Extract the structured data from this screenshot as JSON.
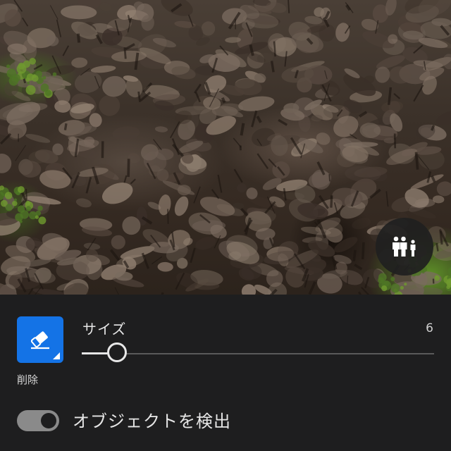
{
  "photo": {
    "people_button_icon": "people-icon"
  },
  "tool": {
    "icon": "eraser-icon",
    "label": "削除",
    "accent_color": "#1473e6"
  },
  "size": {
    "label": "サイズ",
    "value": "6",
    "slider_fraction": 0.08
  },
  "detect_objects": {
    "label": "オブジェクトを検出",
    "enabled": true
  }
}
